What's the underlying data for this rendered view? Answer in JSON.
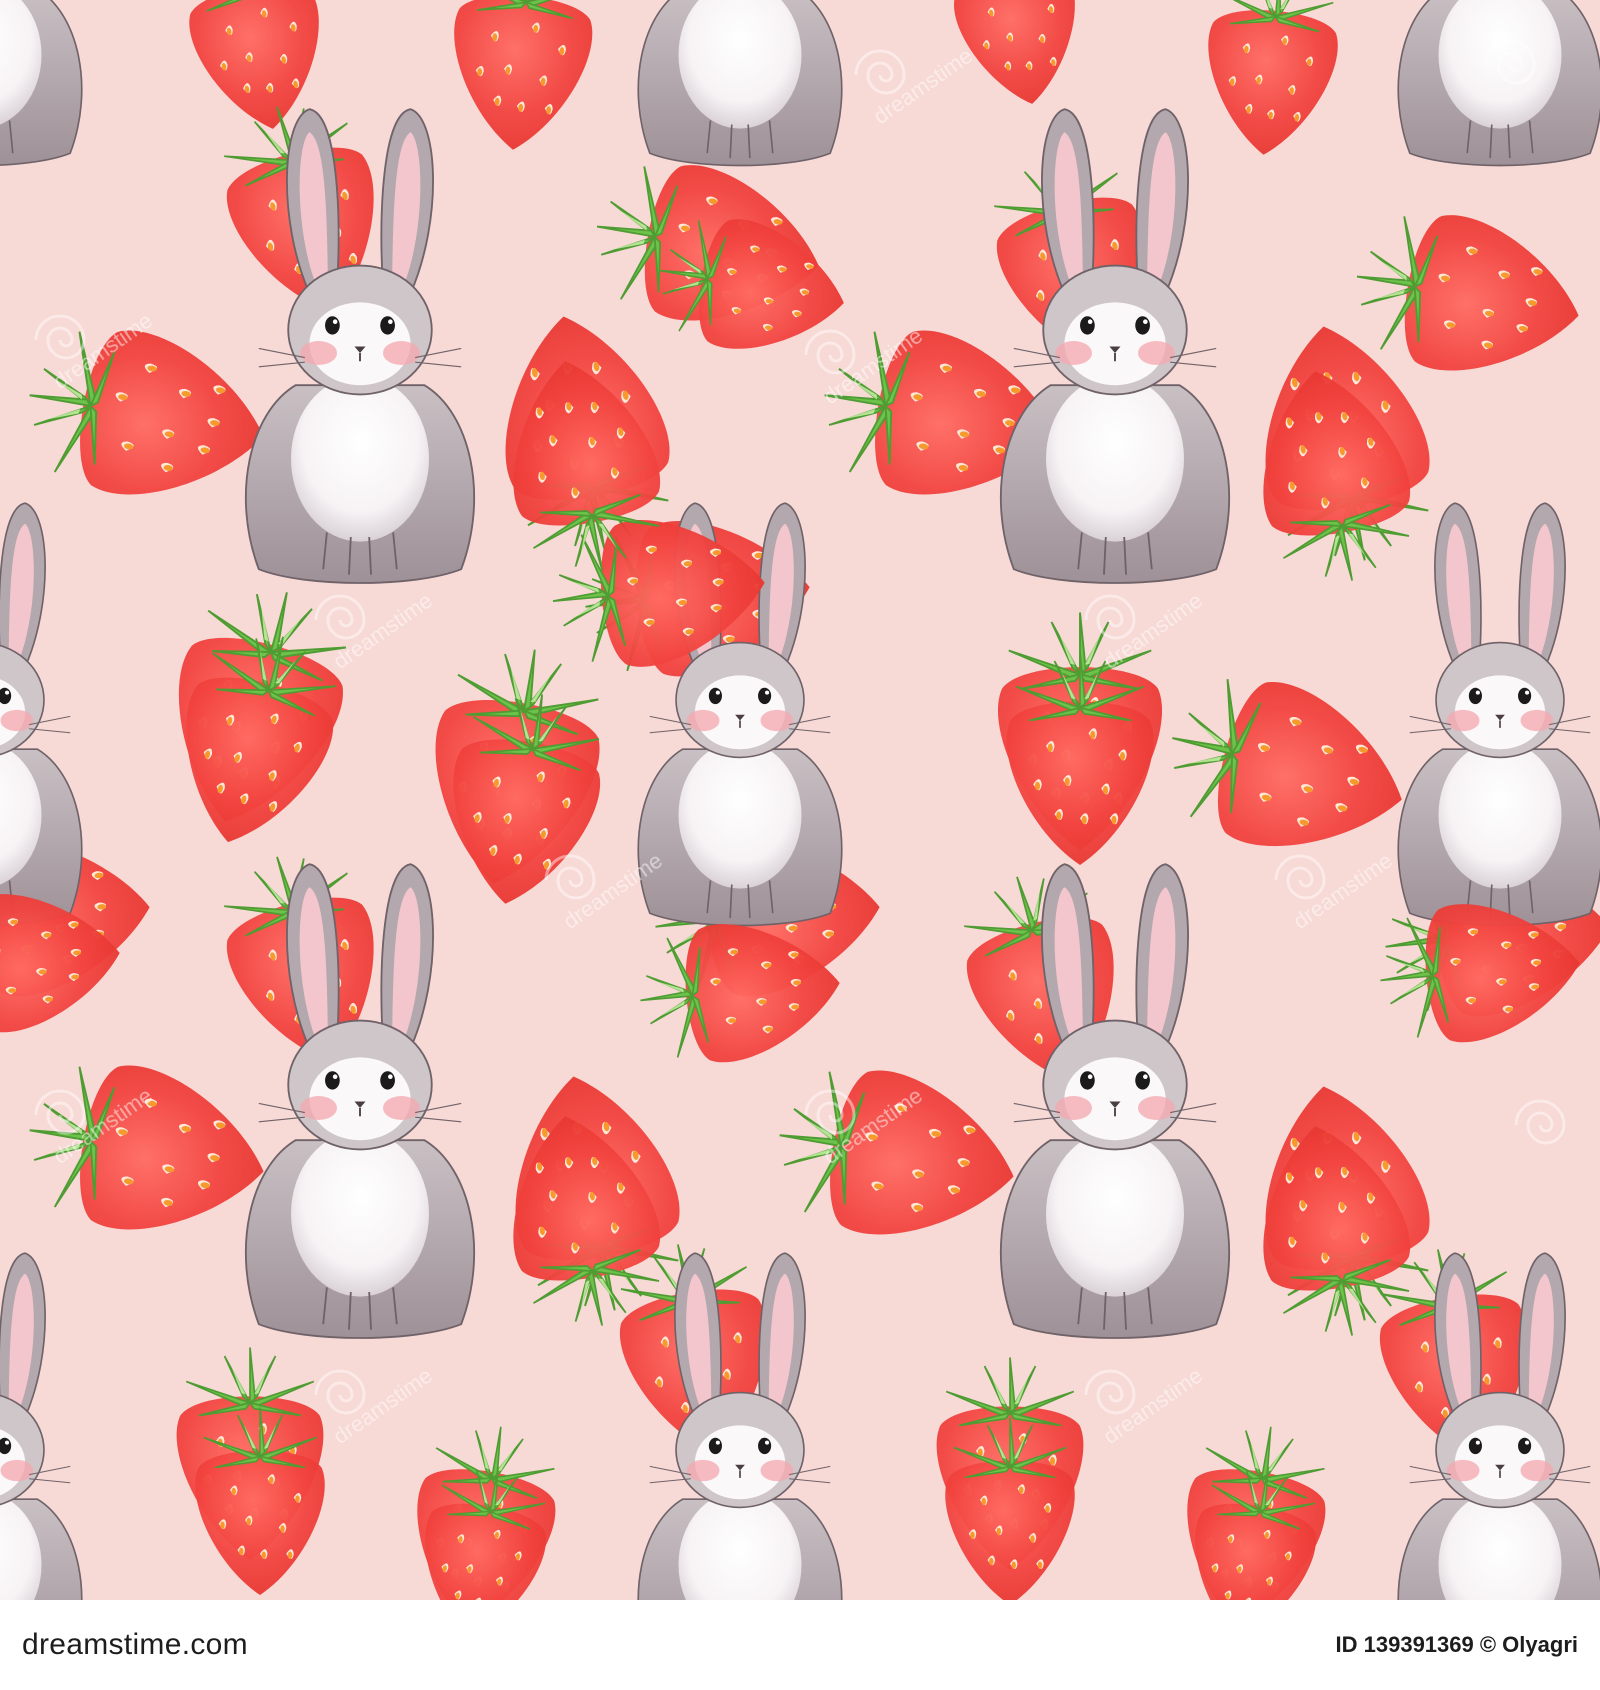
{
  "image": {
    "subject": "seamless-pattern",
    "colors": {
      "background": "#f7d9d6",
      "strawberry": "#f2433f",
      "leaf": "#6cc24a",
      "bunny_fur": "#b3a8ad",
      "bunny_belly": "#ffffff",
      "footer_bg": "#ffffff"
    }
  },
  "watermark": {
    "text": "dreamstime"
  },
  "footer": {
    "brand": "dreamstime.com",
    "credit": "ID 139391369 © Olyagri"
  }
}
